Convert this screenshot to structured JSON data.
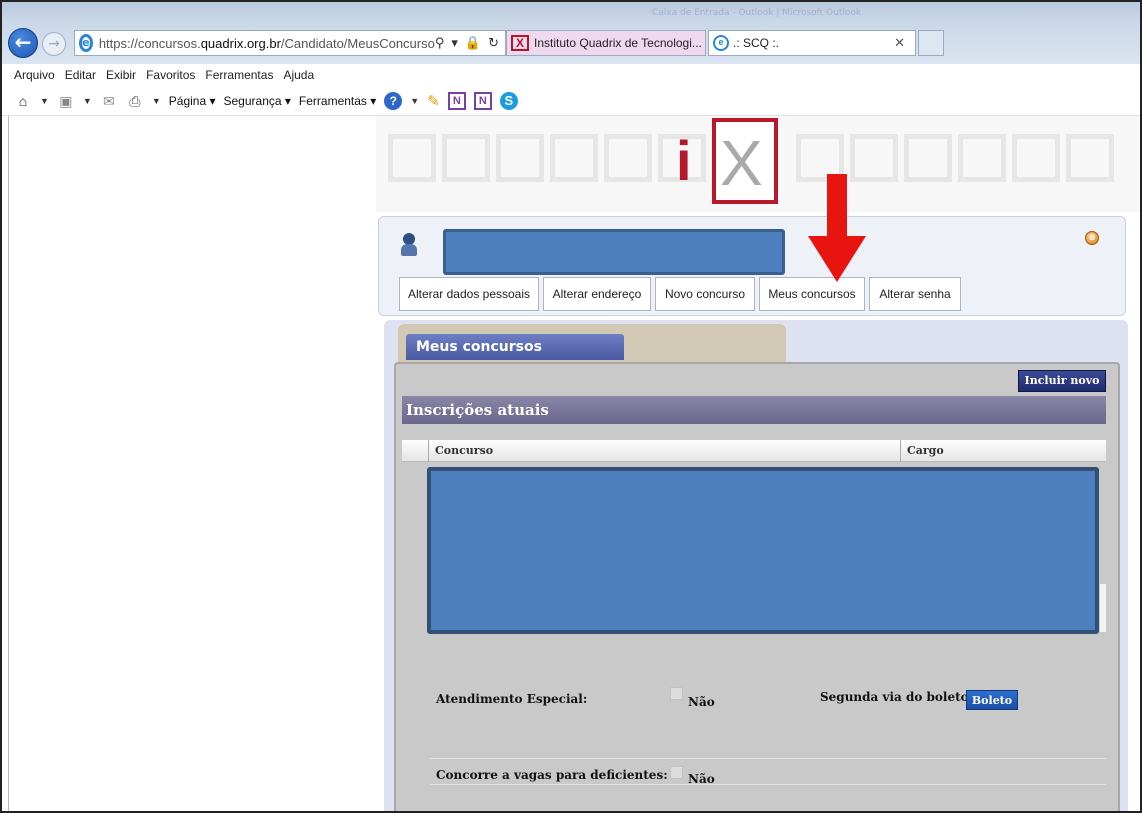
{
  "browser": {
    "window_title": "Caixa de Entrada - Outlook | Microsoft Outlook",
    "url_prefix": "https://concursos.",
    "url_domain": "quadrix.org.br",
    "url_path": "/Candidato/MeusConcurso",
    "address_icons": {
      "search": "⚲",
      "dropdown": "▾",
      "lock": "🔒",
      "refresh": "↻"
    },
    "tabs": [
      {
        "label": "Instituto Quadrix de Tecnologi..."
      },
      {
        "label": ".: SCQ :."
      }
    ],
    "menu": [
      "Arquivo",
      "Editar",
      "Exibir",
      "Favoritos",
      "Ferramentas",
      "Ajuda"
    ],
    "command_bar": {
      "page_label": "Página",
      "security_label": "Segurança",
      "tools_label": "Ferramentas"
    }
  },
  "page": {
    "logo_text": "iX",
    "user_menu": [
      "Alterar dados pessoais",
      "Alterar endereço",
      "Novo concurso",
      "Meus concursos",
      "Alterar senha"
    ],
    "section_tab": "Meus concursos",
    "add_button": "Incluir novo",
    "table_title": "Inscrições atuais",
    "columns": [
      "Concurso",
      "Cargo"
    ],
    "special_service_label": "Atendimento Especial:",
    "special_service_value": "Não",
    "boleto_label": "Segunda via do boleto:",
    "boleto_button": "Boleto",
    "disability_label": "Concorre a vagas para deficientes:",
    "disability_value": "Não"
  },
  "colors": {
    "accent_red": "#e8140f",
    "redaction_blue": "#4e80bf",
    "brand_red": "#b8182b"
  }
}
